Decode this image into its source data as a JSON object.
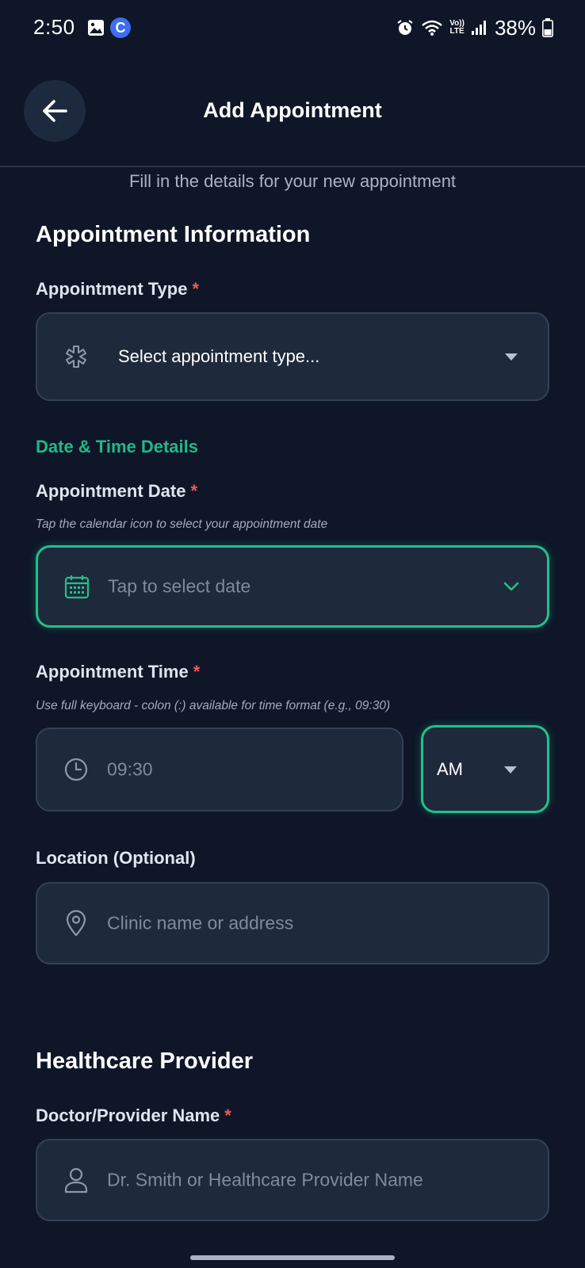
{
  "status_bar": {
    "time": "2:50",
    "notification_letter": "C",
    "lte_top": "Vo))",
    "lte_bottom": "LTE",
    "battery_percent": "38%"
  },
  "header": {
    "title": "Add Appointment"
  },
  "subtitle": "Fill in the details for your new appointment",
  "appointment_info": {
    "section_title": "Appointment Information",
    "type_label": "Appointment Type",
    "required_mark": "*",
    "type_value": "Select appointment type..."
  },
  "date_time": {
    "section_title": "Date & Time Details",
    "date_label": "Appointment Date",
    "date_hint": "Tap the calendar icon to select your appointment date",
    "date_placeholder": "Tap to select date",
    "time_label": "Appointment Time",
    "time_hint": "Use full keyboard - colon (:) available for time format (e.g., 09:30)",
    "time_placeholder": "09:30",
    "period_value": "AM"
  },
  "location": {
    "label": "Location (Optional)",
    "placeholder": "Clinic name or address"
  },
  "provider": {
    "section_title": "Healthcare Provider",
    "name_label": "Doctor/Provider Name",
    "name_placeholder": "Dr. Smith or Healthcare Provider Name"
  },
  "colors": {
    "background": "#0e1628",
    "field_background": "#1e293b",
    "accent_green": "#22c089",
    "required_red": "#ef5a57"
  },
  "icons": {
    "back": "arrow-left-icon",
    "type": "asterisk-icon",
    "date": "calendar-icon",
    "time": "clock-icon",
    "location": "map-pin-icon",
    "provider": "user-icon"
  }
}
